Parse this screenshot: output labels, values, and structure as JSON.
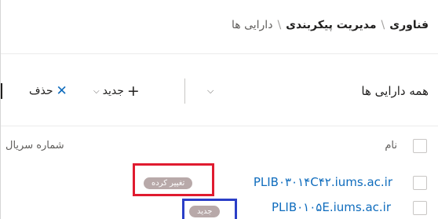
{
  "breadcrumb": {
    "items": [
      "فناوری",
      "مدیریت پیکربندی",
      "دارایی ها"
    ],
    "separator": "\\"
  },
  "toolbar": {
    "view_selector_label": "همه دارایی ها",
    "new_label": "جدید",
    "delete_label": "حذف"
  },
  "table": {
    "columns": {
      "name": "نام",
      "serial": "شماره سریال"
    },
    "rows": [
      {
        "name": "PLIB۰۳۰۱۴C۴۲.iums.ac.ir",
        "status": "تغییر کرده"
      },
      {
        "name": "PLIB۰۱۰۵E.iums.ac.ir",
        "status": "جدید"
      }
    ]
  },
  "colors": {
    "link": "#0f6cbd",
    "badge": "#b8a9a9",
    "highlight_modified": "#e01b2f",
    "highlight_new": "#2b3fc7"
  }
}
